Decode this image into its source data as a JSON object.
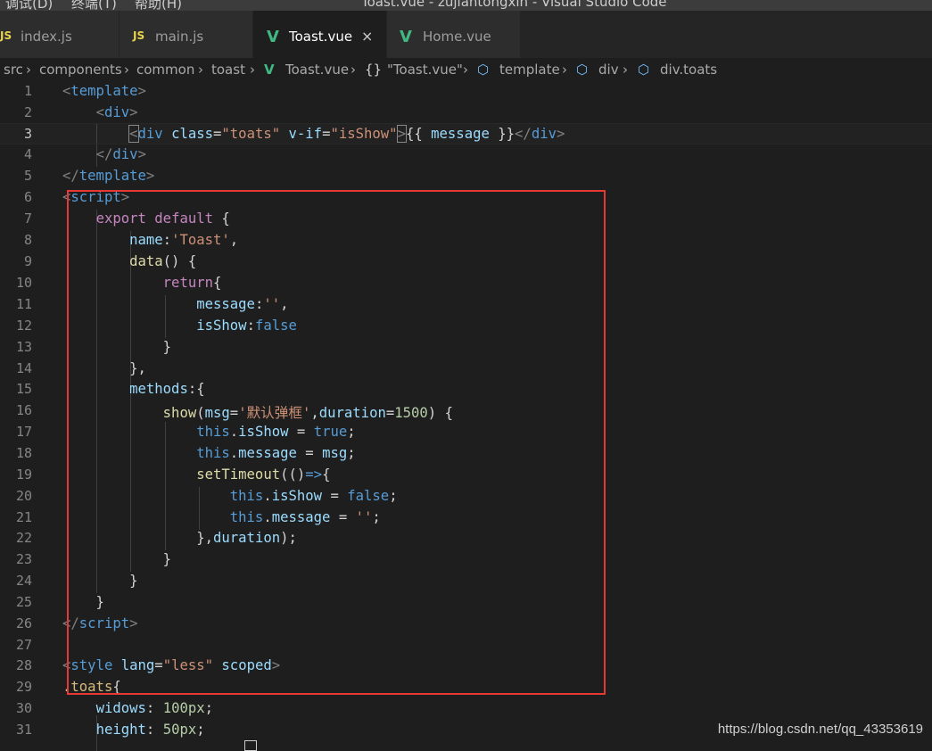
{
  "app": {
    "window_title": "Toast.vue - zujiantongxin - Visual Studio Code",
    "menu": [
      "调试(D)",
      "终端(T)",
      "帮助(H)"
    ]
  },
  "tabs": [
    {
      "icon": "JS",
      "icon_name": "js-file-icon",
      "label": "index.js",
      "active": false
    },
    {
      "icon": "JS",
      "icon_name": "js-file-icon",
      "label": "main.js",
      "active": false
    },
    {
      "icon": "V",
      "icon_name": "vue-file-icon",
      "label": "Toast.vue",
      "active": true,
      "close": "×"
    },
    {
      "icon": "V",
      "icon_name": "vue-file-icon",
      "label": "Home.vue",
      "active": false
    }
  ],
  "breadcrumb": [
    "src",
    "components",
    "common",
    "toast",
    "Toast.vue",
    "\"Toast.vue\"",
    "template",
    "div",
    "div.toats"
  ],
  "line_numbers": [
    "1",
    "2",
    "3",
    "4",
    "5",
    "6",
    "7",
    "8",
    "9",
    "10",
    "11",
    "12",
    "13",
    "14",
    "15",
    "16",
    "17",
    "18",
    "19",
    "20",
    "21",
    "22",
    "23",
    "24",
    "25",
    "26",
    "27",
    "28",
    "29",
    "30",
    "31"
  ],
  "code": {
    "l1": [
      "<",
      "template",
      ">"
    ],
    "l2": [
      "    ",
      "<",
      "div",
      ">"
    ],
    "l3": [
      "        ",
      "<",
      "div",
      " ",
      "class",
      "=",
      "\"toats\"",
      " ",
      "v-if",
      "=",
      "\"isShow\"",
      ">",
      "{{ ",
      "message",
      " }}",
      "</",
      "div",
      ">"
    ],
    "l4": [
      "    ",
      "</",
      "div",
      ">"
    ],
    "l5": [
      "</",
      "template",
      ">"
    ],
    "l6": [
      "<",
      "script",
      ">"
    ],
    "l7": [
      "    ",
      "export",
      " ",
      "default",
      " {"
    ],
    "l8": [
      "        ",
      "name",
      ":",
      "'Toast'",
      ","
    ],
    "l9": [
      "        ",
      "data",
      "() {"
    ],
    "l10": [
      "            ",
      "return",
      "{"
    ],
    "l11": [
      "                ",
      "message",
      ":",
      "''",
      ","
    ],
    "l12": [
      "                ",
      "isShow",
      ":",
      "false"
    ],
    "l13": [
      "            }"
    ],
    "l14": [
      "        },"
    ],
    "l15": [
      "        ",
      "methods",
      ":{"
    ],
    "l16": [
      "            ",
      "show",
      "(",
      "msg",
      "=",
      "'默认弹框'",
      ",",
      "duration",
      "=",
      "1500",
      ") {"
    ],
    "l17": [
      "                ",
      "this",
      ".",
      "isShow",
      " = ",
      "true",
      ";"
    ],
    "l18": [
      "                ",
      "this",
      ".",
      "message",
      " = ",
      "msg",
      ";"
    ],
    "l19": [
      "                ",
      "setTimeout",
      "(()",
      "=>",
      "{"
    ],
    "l20": [
      "                    ",
      "this",
      ".",
      "isShow",
      " = ",
      "false",
      ";"
    ],
    "l21": [
      "                    ",
      "this",
      ".",
      "message",
      " = ",
      "''",
      ";"
    ],
    "l22": [
      "                },",
      "duration",
      ");"
    ],
    "l23": [
      "            }"
    ],
    "l24": [
      "        }"
    ],
    "l25": [
      "    }"
    ],
    "l26": [
      "</",
      "script",
      ">"
    ],
    "l27": [
      ""
    ],
    "l28": [
      "<",
      "style",
      " ",
      "lang",
      "=",
      "\"less\"",
      " ",
      "scoped",
      ">"
    ],
    "l29": [
      ".toats",
      "{"
    ],
    "l30": [
      "    ",
      "widows",
      ": ",
      "100px",
      ";"
    ],
    "l31": [
      "    ",
      "height",
      ": ",
      "50px",
      ";"
    ]
  },
  "watermark": "https://blog.csdn.net/qq_43353619",
  "colors": {
    "highlight_box": "#e53935",
    "editor_bg": "#1e1e1e",
    "vue_green": "#41b883",
    "js_yellow": "#e8d44d"
  }
}
